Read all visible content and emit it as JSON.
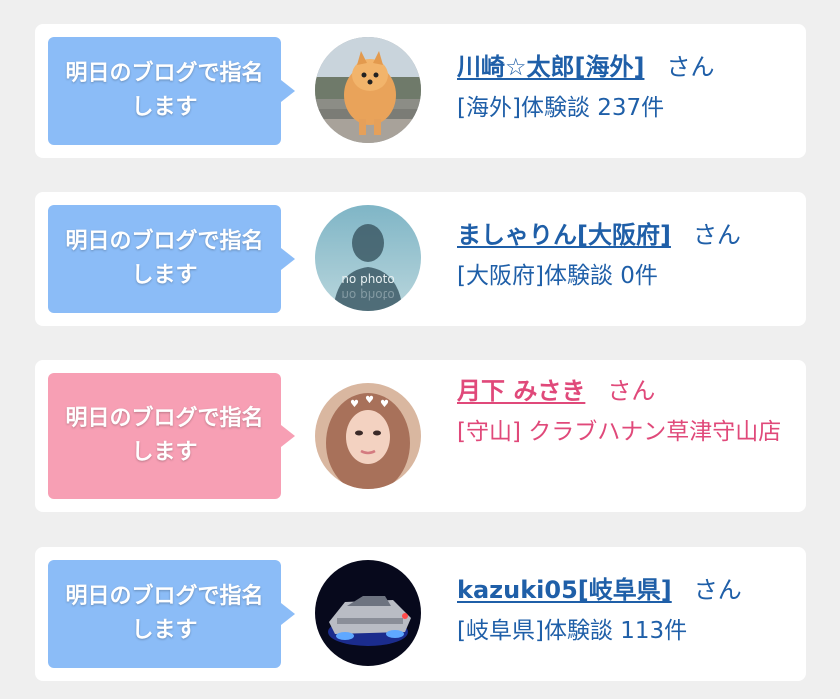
{
  "colors": {
    "card_bg": "#ffffff",
    "page_bg": "#efefef",
    "bubble_blue": "#8bbcf7",
    "bubble_pink": "#f79fb4",
    "text_blue": "#1f5fa8",
    "text_pink": "#e0497a"
  },
  "entries": [
    {
      "bubble": "明日のブログで指名します",
      "name": "川崎☆太郎[海外]",
      "honorific": "さん",
      "detail": "[海外]体験談 237件",
      "avatar": "dog-photo"
    },
    {
      "bubble": "明日のブログで指名します",
      "name": "ましゃりん[大阪府]",
      "honorific": "さん",
      "detail": "[大阪府]体験談 0件",
      "avatar": "no-photo",
      "avatar_text": "no photo"
    },
    {
      "bubble": "明日のブログで指名します",
      "name": "月下 みさき",
      "honorific": "さん",
      "detail": "[守山] クラブハナン草津守山店",
      "avatar": "woman-photo"
    },
    {
      "bubble": "明日のブログで指名します",
      "name": "kazuki05[岐阜県]",
      "honorific": "さん",
      "detail": "[岐阜県]体験談 113件",
      "avatar": "car-photo"
    }
  ]
}
